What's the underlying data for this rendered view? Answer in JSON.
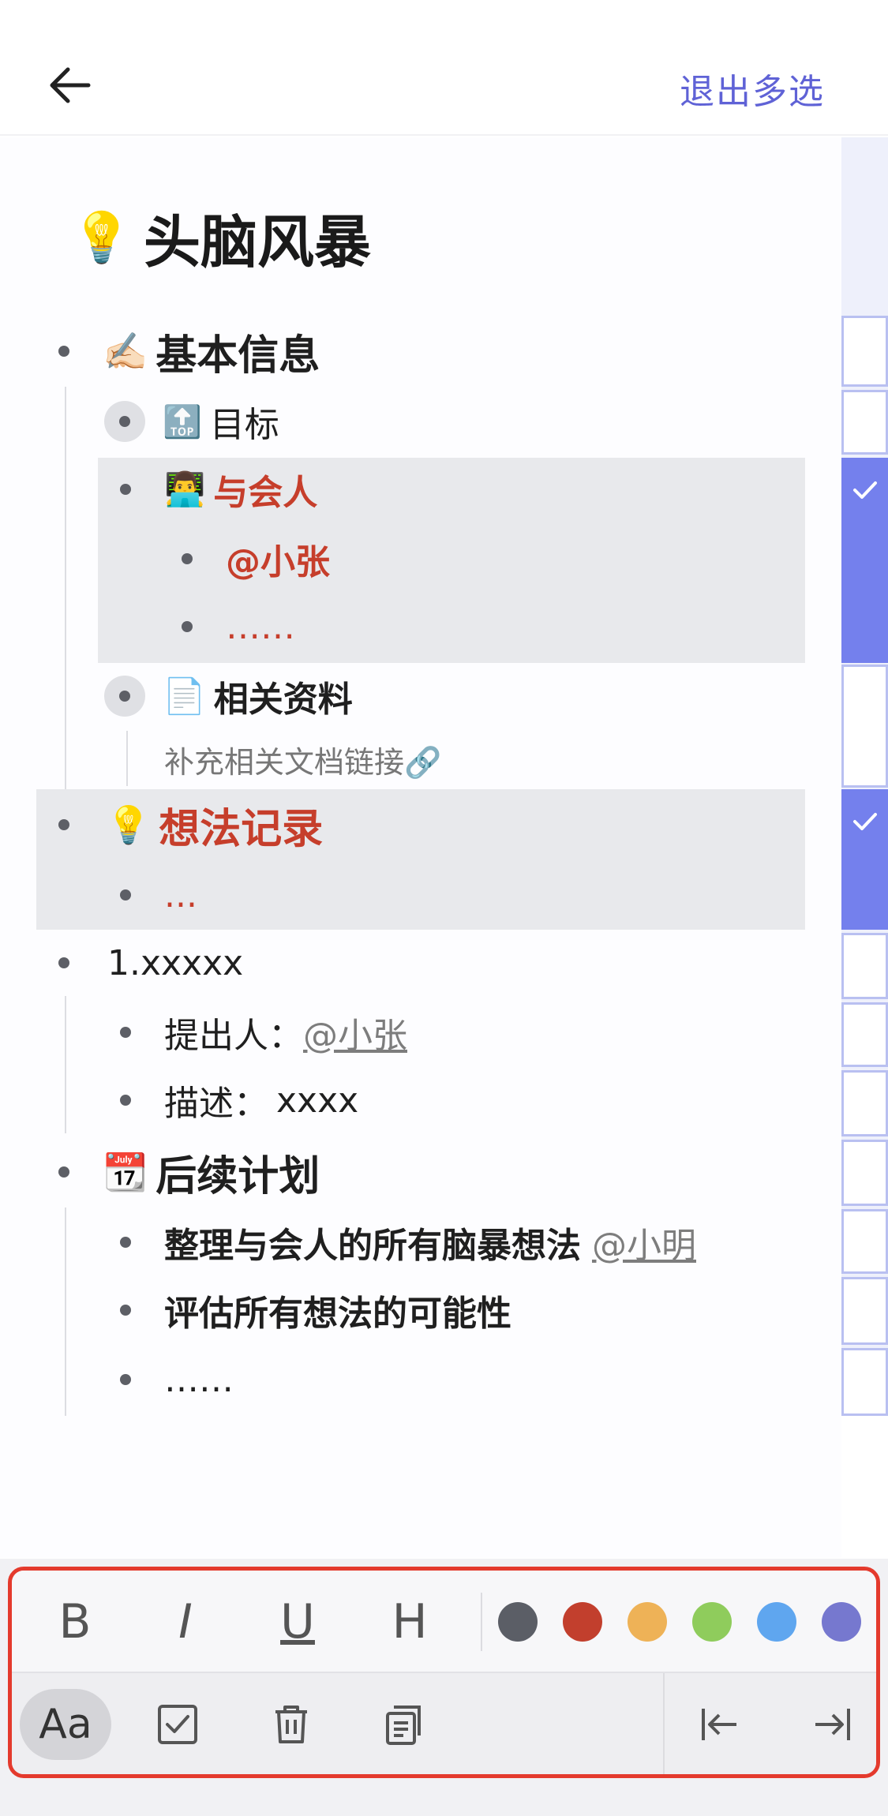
{
  "header": {
    "exit_label": "退出多选"
  },
  "doc": {
    "title_emoji": "💡",
    "title": "头脑风暴",
    "items": [
      {
        "emoji": "✍🏻",
        "text": "基本信息"
      },
      {
        "emoji": "🔝",
        "text": "目标"
      },
      {
        "emoji": "👨‍💻",
        "text": "与会人"
      },
      {
        "text": "@小张"
      },
      {
        "text": "……"
      },
      {
        "emoji": "📄",
        "text": "相关资料"
      },
      {
        "text": "补充相关文档链接🔗"
      },
      {
        "emoji": "💡",
        "text": "想法记录"
      },
      {
        "text": "..."
      },
      {
        "text": "1.xxxxx"
      },
      {
        "label": "提出人：",
        "mention": "@小张"
      },
      {
        "label": "描述：",
        "value": "xxxx"
      },
      {
        "emoji": "📆",
        "text": "后续计划"
      },
      {
        "text": "整理与会人的所有脑暴想法",
        "mention": "@小明"
      },
      {
        "text": "评估所有想法的可能性"
      },
      {
        "text": "……"
      }
    ]
  },
  "toolbar": {
    "bold": "B",
    "italic": "I",
    "underline": "U",
    "heading": "H",
    "text_style": "Aa",
    "colors": [
      "#5b5e66",
      "#c23f2d",
      "#eeb257",
      "#8fcc5c",
      "#5fa6ef",
      "#7678cf"
    ]
  }
}
